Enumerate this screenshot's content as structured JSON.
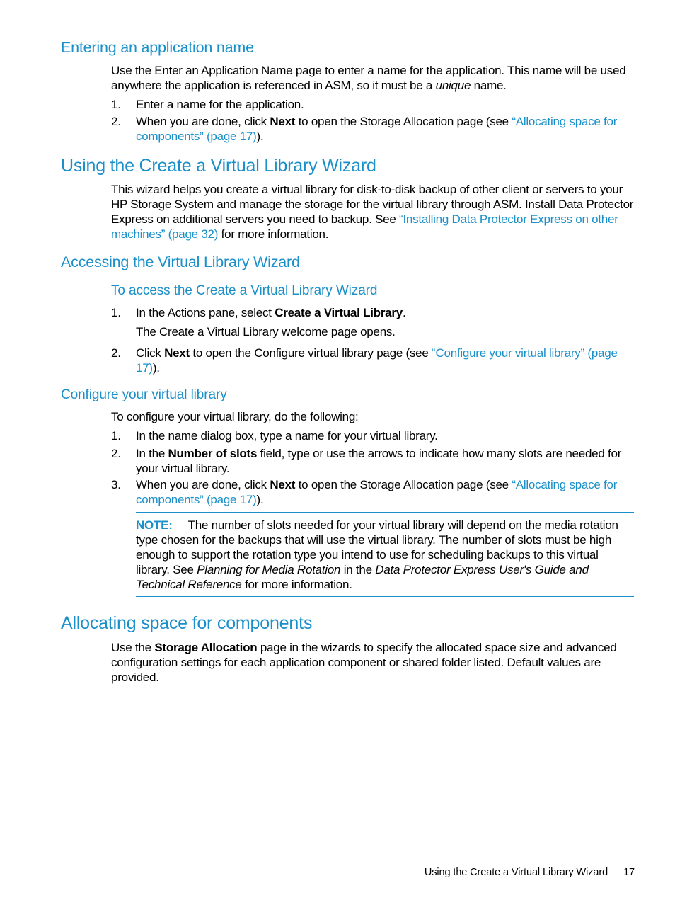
{
  "sections": {
    "entering_name": {
      "heading": "Entering an application name",
      "intro_pre": "Use the Enter an Application Name page to enter a name for the application. This name will be used anywhere the application is referenced in ASM, so it must be a ",
      "intro_em": "unique",
      "intro_post": " name.",
      "steps": [
        {
          "num": "1.",
          "text": "Enter a name for the application."
        },
        {
          "num": "2.",
          "pre": "When you are done, click ",
          "bold": "Next",
          "mid": " to open the Storage Allocation page (see ",
          "link": "“Allocating space for components” (page 17)",
          "post": ")."
        }
      ]
    },
    "using_wizard": {
      "heading": "Using the Create a Virtual Library Wizard",
      "body_pre": "This wizard helps you create a virtual library for disk-to-disk backup of other client or servers to your HP Storage System and manage the storage for the virtual library through ASM. Install Data Protector Express on additional servers you need to backup. See ",
      "body_link": "“Installing Data Protector Express on other machines” (page 32)",
      "body_post": " for more information."
    },
    "accessing_wizard": {
      "heading": "Accessing the Virtual Library Wizard",
      "subheading": "To access the Create a Virtual Library Wizard",
      "steps": [
        {
          "num": "1.",
          "pre": "In the Actions pane, select ",
          "bold": "Create a Virtual Library",
          "post": ".",
          "followup": "The Create a Virtual Library welcome page opens."
        },
        {
          "num": "2.",
          "pre": "Click ",
          "bold": "Next",
          "mid": " to open the Configure virtual library page (see ",
          "link": "“Configure your virtual library” (page 17)",
          "post": ")."
        }
      ]
    },
    "configure_library": {
      "heading": "Configure your virtual library",
      "intro": "To configure your virtual library, do the following:",
      "steps": [
        {
          "num": "1.",
          "text": "In the name dialog box, type a name for your virtual library."
        },
        {
          "num": "2.",
          "pre": "In the ",
          "bold": "Number of slots",
          "post": " field, type or use the arrows to indicate how many slots are needed for your virtual library."
        },
        {
          "num": "3.",
          "pre": "When you are done, click ",
          "bold": "Next",
          "mid": " to open the Storage Allocation page (see ",
          "link": "“Allocating space for components” (page 17)",
          "post": ")."
        }
      ],
      "note": {
        "label": "NOTE:",
        "text1": "The number of slots needed for your virtual library will depend on the media rotation type chosen for the backups that will use the virtual library. The number of slots must be high enough to support the rotation type you intend to use for scheduling backups to this virtual library. See ",
        "em1": "Planning for Media Rotation",
        "text2": " in the ",
        "em2": "Data Protector Express User's Guide and Technical Reference",
        "text3": " for more information."
      }
    },
    "allocating_space": {
      "heading": "Allocating space for components",
      "body_pre": "Use the ",
      "body_bold": "Storage Allocation",
      "body_post": " page in the wizards to specify the allocated space size and advanced configuration settings for each application component or shared folder listed. Default values are provided."
    }
  },
  "footer": {
    "title": "Using the Create a Virtual Library Wizard",
    "page_number": "17"
  },
  "colors": {
    "accent": "#1a8fc9",
    "text": "#000000"
  }
}
